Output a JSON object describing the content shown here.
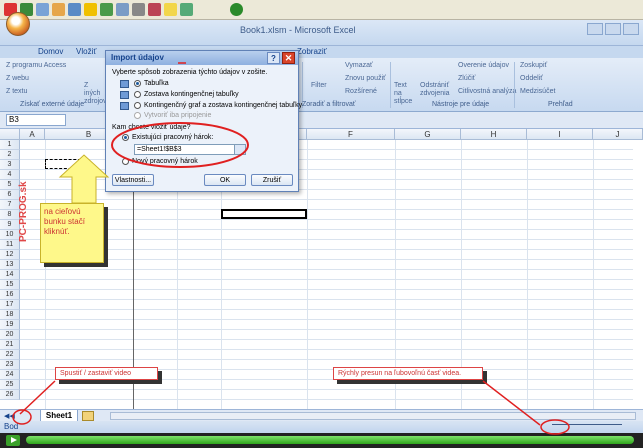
{
  "window": {
    "title": "Book1.xlsm - Microsoft Excel"
  },
  "ribbon": {
    "tabs": [
      "Domov",
      "Vložiť",
      "Zobraziť"
    ],
    "external_data": {
      "items": [
        "Z programu Access",
        "Z webu",
        "Z textu"
      ],
      "partial_item": "Z iných zdrojov",
      "label": "Získať externé údaje"
    },
    "sort_filter": {
      "filter": "Filter",
      "clear": "Vymazať",
      "reapply": "Znovu použiť",
      "advanced": "Rozšírené",
      "label": "Zoradiť a filtrovať"
    },
    "data_tools": {
      "text_to_columns": "Text na stĺpce",
      "remove_duplicates": "Odstrániť zdvojenia",
      "validation": "Overenie údajov",
      "consolidate": "Zlúčiť",
      "whatif": "Citlivostná analýza",
      "label": "Nástroje pre údaje"
    },
    "outline": {
      "group": "Zoskupiť",
      "ungroup": "Oddeliť",
      "subtotal": "Medzisúčet",
      "label": "Prehľad"
    }
  },
  "formula_bar": {
    "name_box": "B3"
  },
  "grid": {
    "columns": [
      "A",
      "B",
      "C",
      "D",
      "E",
      "F",
      "G",
      "H",
      "I",
      "J"
    ],
    "rows": [
      "1",
      "2",
      "3",
      "4",
      "5",
      "6",
      "7",
      "8",
      "9",
      "10",
      "11",
      "12",
      "13",
      "14",
      "15",
      "16",
      "17",
      "18",
      "19",
      "20",
      "21",
      "22",
      "23",
      "24",
      "25",
      "26"
    ]
  },
  "dialog": {
    "title": "Import údajov",
    "help": "?",
    "close": "✕",
    "prompt": "Vyberte spôsob zobrazenia týchto údajov v zošite.",
    "options": [
      "Tabuľka",
      "Zostava kontingenčnej tabuľky",
      "Kontingenčný graf a zostava kontingenčnej tabuľky",
      "Vytvoriť iba pripojenie"
    ],
    "where_label": "Kam chcete vložiť údaje?",
    "existing_sheet": "Existujúci pracovný hárok:",
    "reference": "=Sheet1!$B$3",
    "new_sheet": "Nový pracovný hárok",
    "properties": "Vlastnosti...",
    "ok": "OK",
    "cancel": "Zrušiť"
  },
  "annotations": {
    "note": "na cieľovú bunku stačí kliknúť.",
    "play_hint": "Spustiť / zastaviť video",
    "seek_hint": "Rýchly presun na ľubovoľnú časť videa.",
    "watermark": "PC-PROG.sk"
  },
  "sheets": {
    "active": "Sheet1"
  },
  "status": {
    "mode": "Bod"
  },
  "colors": {
    "accent": "#15428b",
    "annotation_red": "#dd3333",
    "progress_green": "#3aa12a"
  }
}
